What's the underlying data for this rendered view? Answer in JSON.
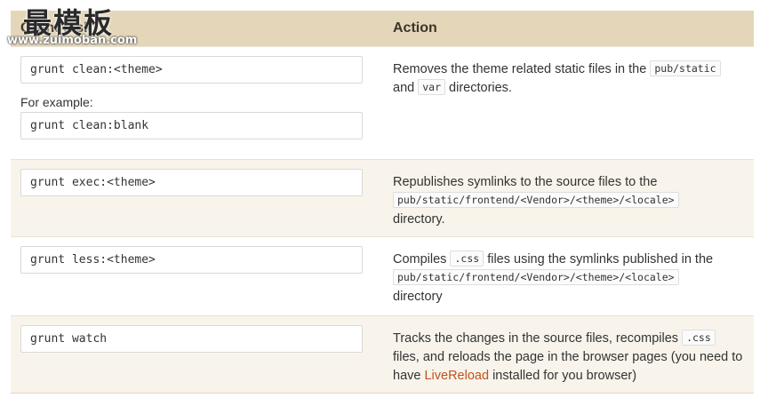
{
  "table": {
    "headers": {
      "command": "Grunt task",
      "action": "Action"
    },
    "rows": [
      {
        "command": "grunt clean:<theme>",
        "example_label": "For example:",
        "example_command": "grunt clean:blank",
        "desc_parts": {
          "t1": "Removes the theme related static files in the",
          "c1": "pub/static",
          "t2": "and",
          "c2": "var",
          "t3": "directories."
        }
      },
      {
        "command": "grunt exec:<theme>",
        "desc_parts": {
          "t1": "Republishes symlinks to the source files to the",
          "c1": "pub/static/frontend/<Vendor>/<theme>/<locale>",
          "t2": "directory."
        }
      },
      {
        "command": "grunt less:<theme>",
        "desc_parts": {
          "t1": "Compiles",
          "c1": ".css",
          "t2": "files using the symlinks published in the",
          "c2": "pub/static/frontend/<Vendor>/<theme>/<locale>",
          "t3": "directory"
        }
      },
      {
        "command": "grunt watch",
        "desc_parts": {
          "t1": "Tracks the changes in the source files, recompiles",
          "c1": ".css",
          "t2": "files, and reloads the page in the browser pages (you need to have",
          "link": "LiveReload",
          "t3": "installed for you browser)"
        }
      }
    ]
  },
  "watermark": {
    "title": "最模板",
    "url": "www.zuimoban.com"
  },
  "colors": {
    "header_bg": "#e4d7b9",
    "alt_row_bg": "#f8f4eb",
    "link": "#c4511c"
  }
}
